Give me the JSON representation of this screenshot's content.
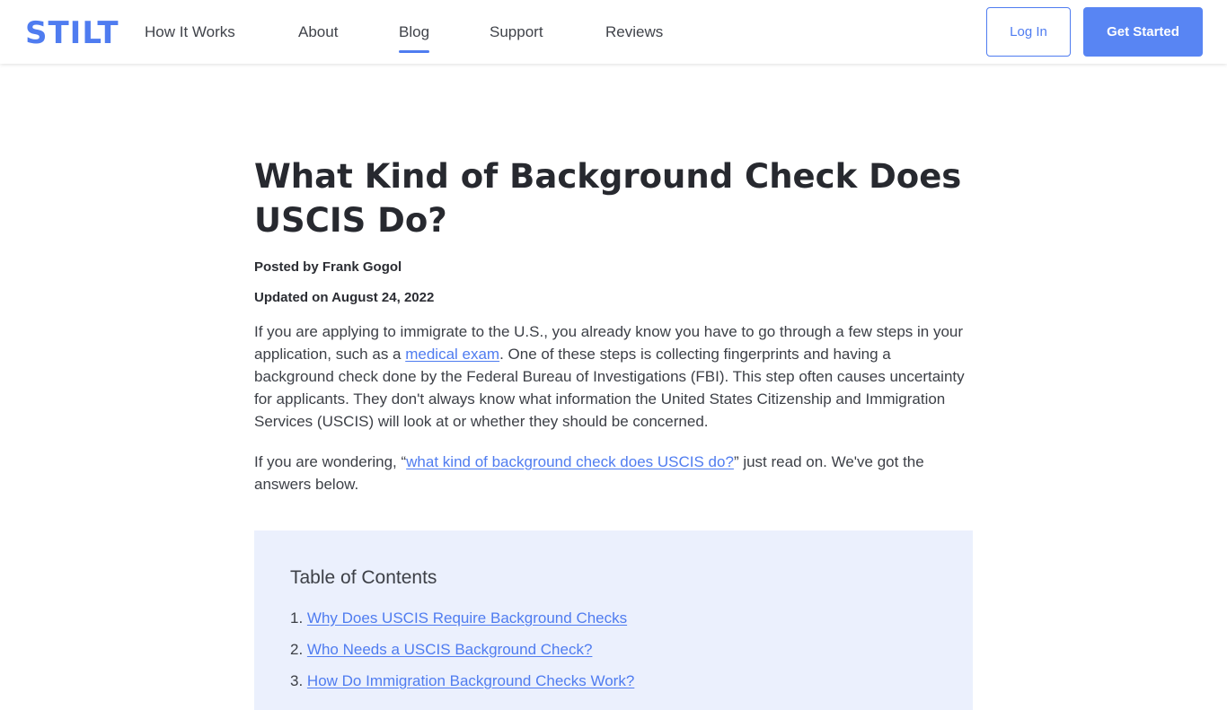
{
  "brand": {
    "logo": "STILT",
    "accent_color": "#4f7cf0"
  },
  "nav": {
    "items": [
      {
        "label": "How It Works"
      },
      {
        "label": "About"
      },
      {
        "label": "Blog",
        "active": true
      },
      {
        "label": "Support"
      },
      {
        "label": "Reviews"
      }
    ],
    "login_label": "Log In",
    "cta_label": "Get Started"
  },
  "article": {
    "title": "What Kind of Background Check Does USCIS Do?",
    "posted_by": "Posted by Frank Gogol",
    "updated_on": "Updated on August 24, 2022",
    "p1": {
      "before": "If you are applying to immigrate to the U.S., you already know you have to go through a few steps in your application, such as a ",
      "link": "medical exam",
      "after": ". One of these steps is collecting fingerprints and having a background check done by the Federal Bureau of Investigations (FBI). This step often causes uncertainty for applicants. They don't always know what information the United States Citizenship and Immigration Services (USCIS) will look at or whether they should be concerned."
    },
    "p2": {
      "before": "If you are wondering, “",
      "link": "what kind of background check does USCIS do?",
      "after": "” just read on. We've got the answers below."
    }
  },
  "toc": {
    "title": "Table of Contents",
    "background_color": "#ebf0fd",
    "items": [
      {
        "number": "1.",
        "label": "Why Does USCIS Require Background Checks"
      },
      {
        "number": "2.",
        "label": "Who Needs a USCIS Background Check?"
      },
      {
        "number": "3.",
        "label": "How Do Immigration Background Checks Work?"
      }
    ]
  }
}
